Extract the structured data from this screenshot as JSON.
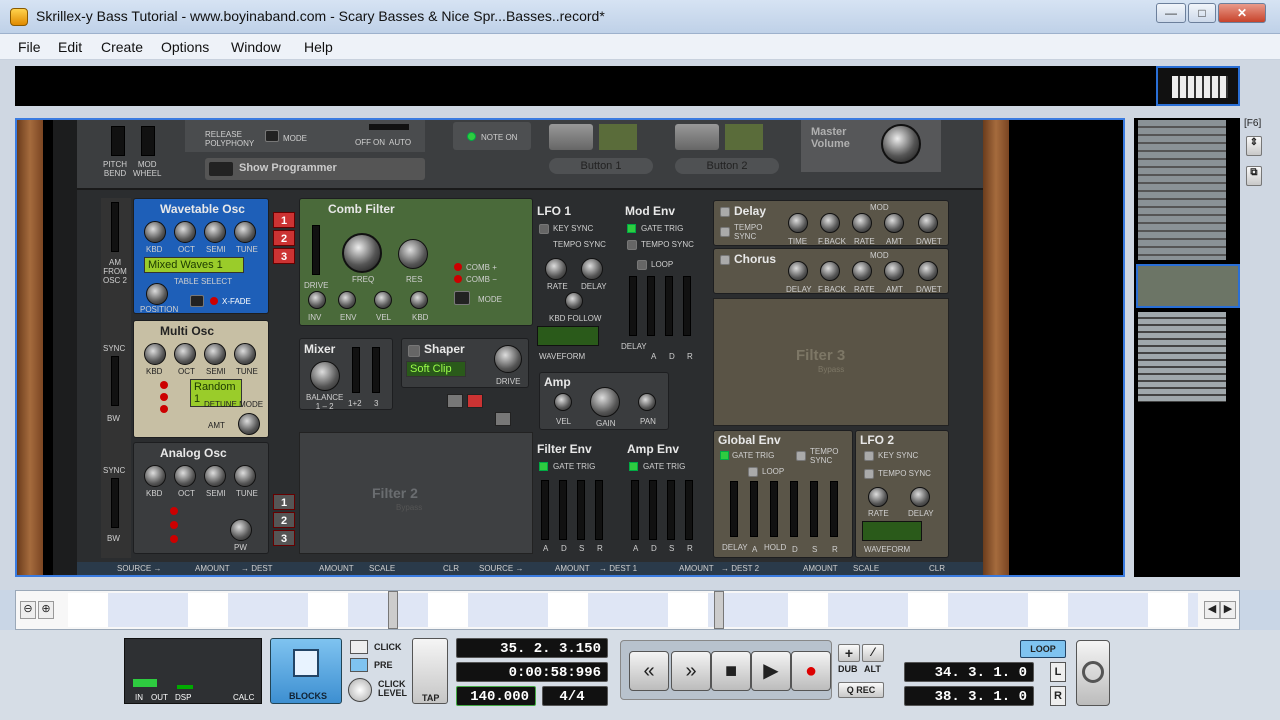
{
  "window": {
    "title": "Skrillex-y Bass Tutorial - www.boyinaband.com - Scary Basses & Nice Spr...Basses..record*",
    "minimize": "—",
    "maximize": "□",
    "close": "✕"
  },
  "menu": [
    "File",
    "Edit",
    "Create",
    "Options",
    "Window",
    "Help"
  ],
  "overview_shortcut": "[F6]",
  "rack": {
    "top_controls": {
      "release_label": "RELEASE\nPOLYPHONY",
      "mode_label": "MODE",
      "off": "OFF",
      "on": "ON",
      "auto": "AUTO",
      "note_on": "NOTE ON",
      "button1": "Button 1",
      "button2": "Button 2",
      "master_volume": "Master\nVolume",
      "pitch_bend": "PITCH\nBEND",
      "mod_wheel": "MOD\nWHEEL",
      "show_programmer": "Show Programmer"
    },
    "wavetable_osc": {
      "title": "Wavetable Osc",
      "knobs": [
        "KBD",
        "OCT",
        "SEMI",
        "TUNE"
      ],
      "table": "Mixed Waves 1",
      "table_select": "TABLE SELECT",
      "position": "POSITION",
      "xfade": "X-FADE"
    },
    "multi_osc": {
      "title": "Multi Osc",
      "knobs": [
        "KBD",
        "OCT",
        "SEMI",
        "TUNE"
      ],
      "mode": "Random 1",
      "detune_mode": "DETUNE MODE",
      "amt": "AMT"
    },
    "analog_osc": {
      "title": "Analog Osc",
      "knobs": [
        "KBD",
        "OCT",
        "SEMI",
        "TUNE"
      ],
      "pw": "PW"
    },
    "side_labels": {
      "am_from_osc2": "AM\nFROM\nOSC 2",
      "sync": "SYNC",
      "bw": "BW"
    },
    "osc_numbers": [
      "1",
      "2",
      "3"
    ],
    "comb_filter": {
      "title": "Comb Filter",
      "freq": "FREQ",
      "res": "RES",
      "drive": "DRIVE",
      "knobs": [
        "INV",
        "ENV",
        "VEL",
        "KBD"
      ],
      "comb_plus": "COMB +",
      "comb_minus": "COMB −",
      "mode": "MODE"
    },
    "mixer": {
      "title": "Mixer",
      "balance": "BALANCE\n1 – 2",
      "l12": "1+2",
      "l3": "3"
    },
    "shaper": {
      "title": "Shaper",
      "mode": "Soft Clip",
      "drive": "DRIVE"
    },
    "filter2": {
      "title": "Filter 2",
      "sub": "Bypass"
    },
    "lfo1": {
      "title": "LFO 1",
      "key_sync": "KEY SYNC",
      "tempo_sync": "TEMPO SYNC",
      "rate": "RATE",
      "delay": "DELAY",
      "kbd_follow": "KBD FOLLOW",
      "waveform": "WAVEFORM"
    },
    "mod_env": {
      "title": "Mod Env",
      "gate_trig": "GATE TRIG",
      "tempo_sync": "TEMPO SYNC",
      "loop": "LOOP",
      "sliders": [
        "DELAY",
        "A",
        "D",
        "R"
      ]
    },
    "amp": {
      "title": "Amp",
      "vel": "VEL",
      "gain": "GAIN",
      "pan": "PAN"
    },
    "filter_env": {
      "title": "Filter Env",
      "gate_trig": "GATE TRIG",
      "sliders": [
        "A",
        "D",
        "S",
        "R"
      ]
    },
    "amp_env": {
      "title": "Amp Env",
      "gate_trig": "GATE TRIG",
      "sliders": [
        "A",
        "D",
        "S",
        "R"
      ]
    },
    "delay": {
      "title": "Delay",
      "tempo_sync": "TEMPO\nSYNC",
      "mod": "MOD",
      "knobs": [
        "TIME",
        "F.BACK",
        "RATE",
        "AMT",
        "D/WET"
      ]
    },
    "chorus": {
      "title": "Chorus",
      "mod": "MOD",
      "knobs": [
        "DELAY",
        "F.BACK",
        "RATE",
        "AMT",
        "D/WET"
      ]
    },
    "filter3": {
      "title": "Filter 3",
      "sub": "Bypass"
    },
    "global_env": {
      "title": "Global Env",
      "gate_trig": "GATE TRIG",
      "tempo_sync": "TEMPO\nSYNC",
      "loop": "LOOP",
      "sliders": [
        "DELAY",
        "A",
        "HOLD",
        "D",
        "S",
        "R"
      ]
    },
    "lfo2": {
      "title": "LFO 2",
      "key_sync": "KEY SYNC",
      "tempo_sync": "TEMPO SYNC",
      "rate": "RATE",
      "delay": "DELAY",
      "waveform": "WAVEFORM"
    },
    "bottom_strip": [
      "SOURCE →",
      "AMOUNT",
      "→ DEST",
      "AMOUNT",
      "SCALE",
      "CLR",
      "SOURCE →",
      "AMOUNT",
      "→ DEST 1",
      "AMOUNT",
      "→ DEST 2",
      "AMOUNT",
      "SCALE",
      "CLR"
    ]
  },
  "transport": {
    "in": "IN",
    "out": "OUT",
    "dsp": "DSP",
    "calc": "CALC",
    "blocks": "BLOCKS",
    "click": "CLICK",
    "pre": "PRE",
    "click_level": "CLICK\nLEVEL",
    "tap": "TAP",
    "position": "35.  2.  3.150",
    "time": "0:00:58:996",
    "tempo": "140.000",
    "signature": "4/4",
    "dub": "DUB",
    "alt": "ALT",
    "qrec": "Q REC",
    "loop": "LOOP",
    "left_locator": "34.  3.  1.    0",
    "right_locator": "38.  3.  1.    0",
    "l": "L",
    "r": "R"
  }
}
